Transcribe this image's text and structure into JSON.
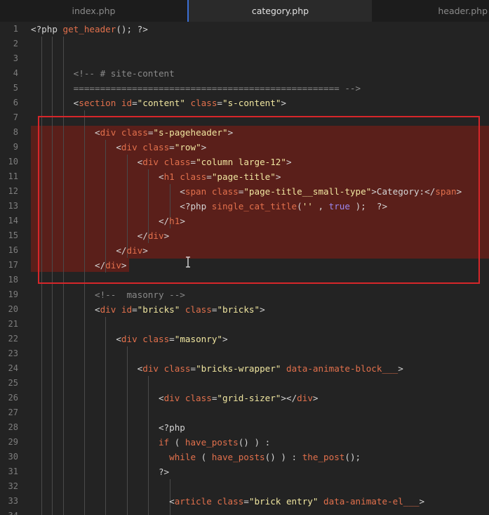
{
  "tabs": [
    {
      "label": "index.php",
      "active": false
    },
    {
      "label": "category.php",
      "active": true
    },
    {
      "label": "header.php",
      "active": false
    }
  ],
  "colors": {
    "selection": "#5a1f1a",
    "highlight_border": "#d6262a",
    "active_tab_indicator": "#3b6fd4"
  },
  "lines": [
    {
      "n": "1",
      "tokens": [
        [
          "php",
          "<?php "
        ],
        [
          "fn",
          "get_header"
        ],
        [
          "php",
          "(); ?>"
        ]
      ]
    },
    {
      "n": "2",
      "tokens": []
    },
    {
      "n": "3",
      "tokens": []
    },
    {
      "n": "4",
      "tokens": [
        [
          "com",
          "        <!-- # site-content"
        ]
      ]
    },
    {
      "n": "5",
      "tokens": [
        [
          "com",
          "        ================================================== -->"
        ]
      ]
    },
    {
      "n": "6",
      "tokens": [
        [
          "txt",
          "        <"
        ],
        [
          "tag",
          "section"
        ],
        [
          "attr",
          " id"
        ],
        [
          "txt",
          "="
        ],
        [
          "str",
          "\"content\""
        ],
        [
          "attr",
          " class"
        ],
        [
          "txt",
          "="
        ],
        [
          "str",
          "\"s-content\""
        ],
        [
          "txt",
          ">"
        ]
      ]
    },
    {
      "n": "7",
      "tokens": []
    },
    {
      "n": "8",
      "tokens": [
        [
          "txt",
          "            <"
        ],
        [
          "tag",
          "div"
        ],
        [
          "attr",
          " class"
        ],
        [
          "txt",
          "="
        ],
        [
          "str",
          "\"s-pageheader\""
        ],
        [
          "txt",
          ">"
        ]
      ]
    },
    {
      "n": "9",
      "tokens": [
        [
          "txt",
          "                <"
        ],
        [
          "tag",
          "div"
        ],
        [
          "attr",
          " class"
        ],
        [
          "txt",
          "="
        ],
        [
          "str",
          "\"row\""
        ],
        [
          "txt",
          ">"
        ]
      ]
    },
    {
      "n": "10",
      "tokens": [
        [
          "txt",
          "                    <"
        ],
        [
          "tag",
          "div"
        ],
        [
          "attr",
          " class"
        ],
        [
          "txt",
          "="
        ],
        [
          "str",
          "\"column large-12\""
        ],
        [
          "txt",
          ">"
        ]
      ]
    },
    {
      "n": "11",
      "tokens": [
        [
          "txt",
          "                        <"
        ],
        [
          "tag",
          "h1"
        ],
        [
          "attr",
          " class"
        ],
        [
          "txt",
          "="
        ],
        [
          "str",
          "\"page-title\""
        ],
        [
          "txt",
          ">"
        ]
      ]
    },
    {
      "n": "12",
      "tokens": [
        [
          "txt",
          "                            <"
        ],
        [
          "tag",
          "span"
        ],
        [
          "attr",
          " class"
        ],
        [
          "txt",
          "="
        ],
        [
          "str",
          "\"page-title__small-type\""
        ],
        [
          "txt",
          ">Category:</"
        ],
        [
          "tag",
          "span"
        ],
        [
          "txt",
          ">"
        ]
      ]
    },
    {
      "n": "13",
      "tokens": [
        [
          "txt",
          "                            <?php "
        ],
        [
          "fn",
          "single_cat_title"
        ],
        [
          "txt",
          "("
        ],
        [
          "str",
          "''"
        ],
        [
          "txt",
          " , "
        ],
        [
          "bool",
          "true"
        ],
        [
          "txt",
          " );  ?>"
        ]
      ]
    },
    {
      "n": "14",
      "tokens": [
        [
          "txt",
          "                        </"
        ],
        [
          "tag",
          "h1"
        ],
        [
          "txt",
          ">"
        ]
      ]
    },
    {
      "n": "15",
      "tokens": [
        [
          "txt",
          "                    </"
        ],
        [
          "tag",
          "div"
        ],
        [
          "txt",
          ">"
        ]
      ]
    },
    {
      "n": "16",
      "tokens": [
        [
          "txt",
          "                </"
        ],
        [
          "tag",
          "div"
        ],
        [
          "txt",
          ">"
        ]
      ]
    },
    {
      "n": "17",
      "tokens": [
        [
          "txt",
          "            </"
        ],
        [
          "tag",
          "div"
        ],
        [
          "txt",
          ">"
        ]
      ]
    },
    {
      "n": "18",
      "tokens": []
    },
    {
      "n": "19",
      "tokens": [
        [
          "com",
          "            <!--  masonry -->"
        ]
      ]
    },
    {
      "n": "20",
      "tokens": [
        [
          "txt",
          "            <"
        ],
        [
          "tag",
          "div"
        ],
        [
          "attr",
          " id"
        ],
        [
          "txt",
          "="
        ],
        [
          "str",
          "\"bricks\""
        ],
        [
          "attr",
          " class"
        ],
        [
          "txt",
          "="
        ],
        [
          "str",
          "\"bricks\""
        ],
        [
          "txt",
          ">"
        ]
      ]
    },
    {
      "n": "21",
      "tokens": []
    },
    {
      "n": "22",
      "tokens": [
        [
          "txt",
          "                <"
        ],
        [
          "tag",
          "div"
        ],
        [
          "attr",
          " class"
        ],
        [
          "txt",
          "="
        ],
        [
          "str",
          "\"masonry\""
        ],
        [
          "txt",
          ">"
        ]
      ]
    },
    {
      "n": "23",
      "tokens": []
    },
    {
      "n": "24",
      "tokens": [
        [
          "txt",
          "                    <"
        ],
        [
          "tag",
          "div"
        ],
        [
          "attr",
          " class"
        ],
        [
          "txt",
          "="
        ],
        [
          "str",
          "\"bricks-wrapper\""
        ],
        [
          "attr",
          " data-animate-block___"
        ],
        [
          "txt",
          ">"
        ]
      ]
    },
    {
      "n": "25",
      "tokens": []
    },
    {
      "n": "26",
      "tokens": [
        [
          "txt",
          "                        <"
        ],
        [
          "tag",
          "div"
        ],
        [
          "attr",
          " class"
        ],
        [
          "txt",
          "="
        ],
        [
          "str",
          "\"grid-sizer\""
        ],
        [
          "txt",
          "></"
        ],
        [
          "tag",
          "div"
        ],
        [
          "txt",
          ">"
        ]
      ]
    },
    {
      "n": "27",
      "tokens": []
    },
    {
      "n": "28",
      "tokens": [
        [
          "txt",
          "                        <?php"
        ]
      ]
    },
    {
      "n": "29",
      "tokens": [
        [
          "kw",
          "                        if"
        ],
        [
          "txt",
          " ( "
        ],
        [
          "fn",
          "have_posts"
        ],
        [
          "txt",
          "() ) :"
        ]
      ]
    },
    {
      "n": "30",
      "tokens": [
        [
          "kw",
          "                          while"
        ],
        [
          "txt",
          " ( "
        ],
        [
          "fn",
          "have_posts"
        ],
        [
          "txt",
          "() ) : "
        ],
        [
          "fn",
          "the_post"
        ],
        [
          "txt",
          "();"
        ]
      ]
    },
    {
      "n": "31",
      "tokens": [
        [
          "txt",
          "                        ?>"
        ]
      ]
    },
    {
      "n": "32",
      "tokens": []
    },
    {
      "n": "33",
      "tokens": [
        [
          "txt",
          "                          <"
        ],
        [
          "tag",
          "article"
        ],
        [
          "attr",
          " class"
        ],
        [
          "txt",
          "="
        ],
        [
          "str",
          "\"brick entry\""
        ],
        [
          "attr",
          " data-animate-el___"
        ],
        [
          "txt",
          ">"
        ]
      ]
    },
    {
      "n": "34",
      "tokens": []
    }
  ]
}
